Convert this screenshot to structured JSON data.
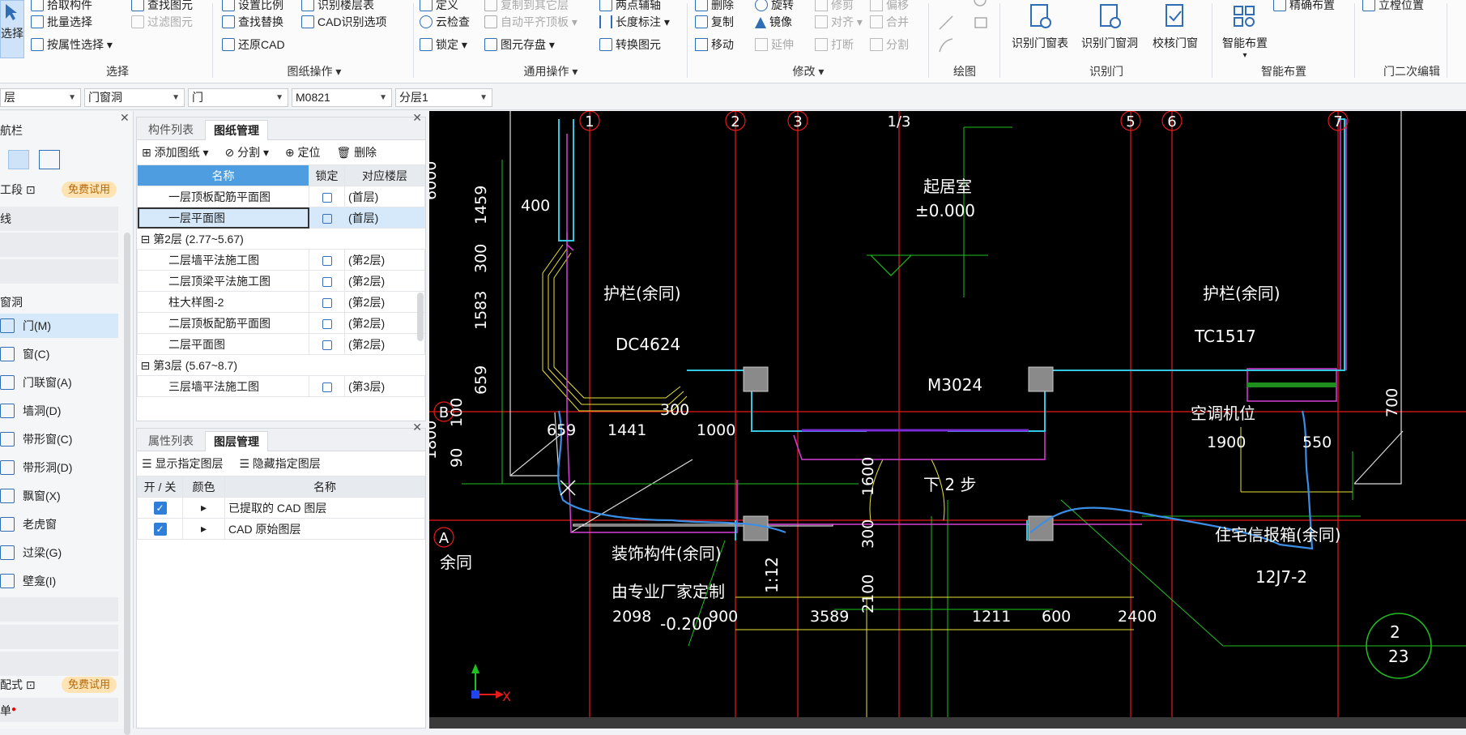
{
  "ribbon": {
    "select_big": "选择",
    "select_group": {
      "items": [
        "拾取构件",
        "批量选择",
        "按属性选择",
        "查找图元",
        "过滤图元"
      ],
      "label": "选择"
    },
    "drawing_ops": {
      "items": [
        "设置比例",
        "识别楼层表",
        "查找替换",
        "CAD识别选项",
        "还原CAD"
      ],
      "label": "图纸操作"
    },
    "common_ops": {
      "items": [
        "定义",
        "复制到其它层",
        "两点辅轴",
        "云检查",
        "自动平齐顶板",
        "长度标注",
        "锁定",
        "图元存盘",
        "转换图元"
      ],
      "label": "通用操作"
    },
    "modify": {
      "items": [
        "删除",
        "旋转",
        "修剪",
        "偏移",
        "复制",
        "镜像",
        "对齐",
        "合并",
        "移动",
        "延伸",
        "打断",
        "分割"
      ],
      "label": "修改"
    },
    "draw": {
      "label": "绘图"
    },
    "identify_door": {
      "items": [
        "识别门窗表",
        "识别门窗洞",
        "校核门窗"
      ],
      "label": "识别门"
    },
    "smart": {
      "items": [
        "智能布置",
        "精确布置"
      ],
      "label": "智能布置"
    },
    "door2": {
      "items": [
        "立樘位置"
      ],
      "label": "门二次编辑"
    }
  },
  "filterbar": {
    "combos": [
      "层",
      "门窗洞",
      "门",
      "M0821",
      "分层1"
    ]
  },
  "nav": {
    "title": "航栏",
    "section1": "工段",
    "trial": "免费试用",
    "row_line": "线",
    "section_door": "窗洞",
    "items": [
      "门(M)",
      "窗(C)",
      "门联窗(A)",
      "墙洞(D)",
      "带形窗(C)",
      "带形洞(D)",
      "飘窗(X)",
      "老虎窗",
      "过梁(G)",
      "壁龛(I)"
    ],
    "section2": "配式",
    "trial2": "免费试用",
    "row_last": "单"
  },
  "drawing_panel": {
    "tabs": [
      "构件列表",
      "图纸管理"
    ],
    "toolbar": [
      "添加图纸",
      "分割",
      "定位",
      "删除"
    ],
    "columns": [
      "名称",
      "锁定",
      "对应楼层"
    ],
    "rows": [
      {
        "type": "item",
        "name": "一层顶板配筋平面图",
        "floor": "(首层)"
      },
      {
        "type": "item",
        "name": "一层平面图",
        "floor": "(首层)",
        "selected": true
      },
      {
        "type": "group",
        "name": "第2层 (2.77~5.67)"
      },
      {
        "type": "item",
        "name": "二层墙平法施工图",
        "floor": "(第2层)"
      },
      {
        "type": "item",
        "name": "二层顶梁平法施工图",
        "floor": "(第2层)"
      },
      {
        "type": "item",
        "name": "柱大样图-2",
        "floor": "(第2层)"
      },
      {
        "type": "item",
        "name": "二层顶板配筋平面图",
        "floor": "(第2层)"
      },
      {
        "type": "item",
        "name": "二层平面图",
        "floor": "(第2层)"
      },
      {
        "type": "group",
        "name": "第3层 (5.67~8.7)"
      },
      {
        "type": "item",
        "name": "三层墙平法施工图",
        "floor": "(第3层)"
      }
    ]
  },
  "layer_panel": {
    "tabs": [
      "属性列表",
      "图层管理"
    ],
    "toolbar": [
      "显示指定图层",
      "隐藏指定图层"
    ],
    "columns": [
      "开 / 关",
      "颜色",
      "名称"
    ],
    "rows": [
      {
        "name": "已提取的 CAD 图层"
      },
      {
        "name": "CAD 原始图层"
      }
    ]
  },
  "cad": {
    "axes_top": [
      "1",
      "2",
      "3",
      "1/3",
      "5",
      "6",
      "7"
    ],
    "axes_left": [
      "B",
      "A"
    ],
    "texts": [
      "起居室",
      "±0.000",
      "护栏(余同)",
      "护栏(余同)",
      "DC4624",
      "TC1517",
      "M3024",
      "空调机位",
      "下 2 步",
      "装饰构件(余同)",
      "由专业厂家定制",
      "住宅信报箱(余同)",
      "12J7-2",
      "2",
      "23",
      "余同",
      "-0.200",
      "1:12"
    ],
    "dims": [
      "6000",
      "1459",
      "300",
      "1583",
      "659",
      "100",
      "1800",
      "90",
      "400",
      "659",
      "1441",
      "300",
      "1000",
      "1900",
      "550",
      "700",
      "1600",
      "300",
      "2100",
      "2098",
      "900",
      "3589",
      "1211",
      "600",
      "2400"
    ],
    "axis_x": "X"
  }
}
